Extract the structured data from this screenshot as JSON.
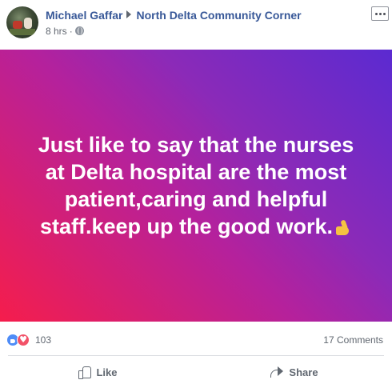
{
  "post": {
    "author": "Michael Gaffar",
    "group": "North Delta Community Corner",
    "time": "8 hrs",
    "separator": "·",
    "text": "Just like to say that the nurses at Delta hospital are the most patient,caring and helpful staff.keep up the good work.",
    "emoji_icon": "thumbs-up-emoji",
    "background_colors": [
      "#f51d4c",
      "#b5219c",
      "#5b2ad1"
    ]
  },
  "reactions": {
    "count": "103",
    "icons": [
      "like-icon",
      "love-icon"
    ],
    "comments": "17 Comments"
  },
  "actions": {
    "like_label": "Like",
    "share_label": "Share"
  }
}
